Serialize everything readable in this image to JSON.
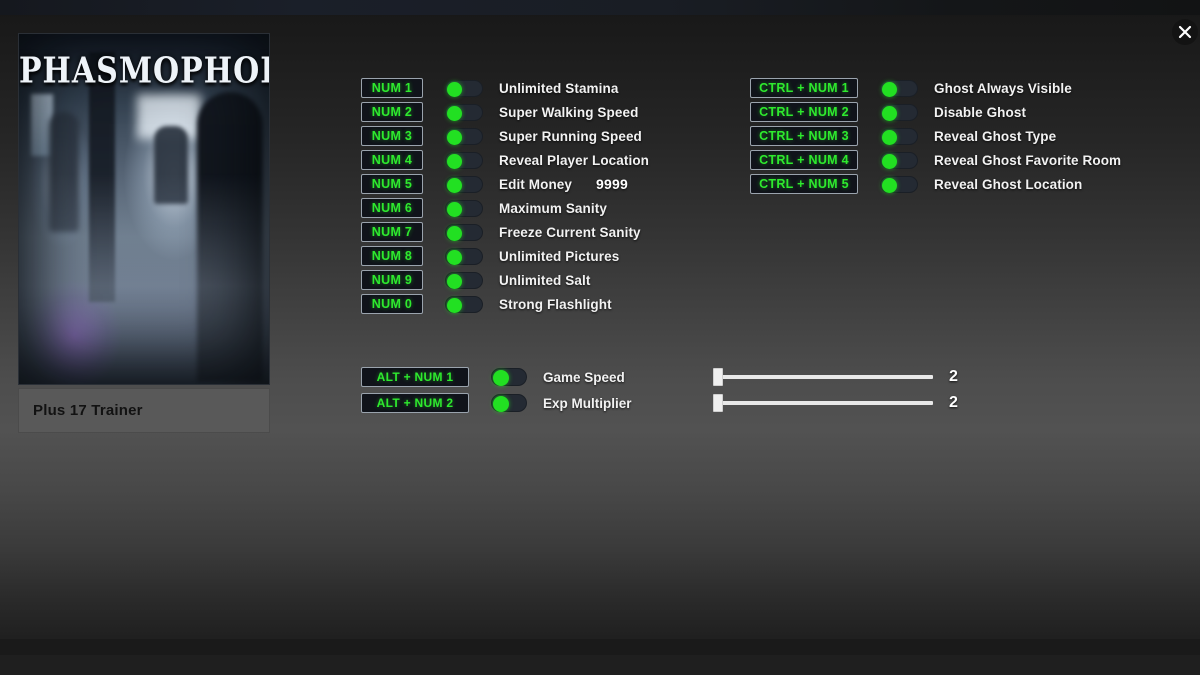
{
  "window": {
    "close_label": "✕"
  },
  "game": {
    "title": "PHASMOPHOBIA",
    "trainer_label": "Plus 17 Trainer",
    "cover_alt": "phasmophobia-cover-art"
  },
  "columns": {
    "left": [
      {
        "hotkey": "NUM 1",
        "label": "Unlimited Stamina",
        "enabled": true
      },
      {
        "hotkey": "NUM 2",
        "label": "Super Walking Speed",
        "enabled": true
      },
      {
        "hotkey": "NUM 3",
        "label": "Super Running Speed",
        "enabled": true
      },
      {
        "hotkey": "NUM 4",
        "label": "Reveal Player Location",
        "enabled": true
      },
      {
        "hotkey": "NUM 5",
        "label": "Edit Money",
        "value": "9999",
        "enabled": true
      },
      {
        "hotkey": "NUM 6",
        "label": "Maximum Sanity",
        "enabled": true
      },
      {
        "hotkey": "NUM 7",
        "label": "Freeze Current Sanity",
        "enabled": true
      },
      {
        "hotkey": "NUM 8",
        "label": "Unlimited Pictures",
        "enabled": true
      },
      {
        "hotkey": "NUM 9",
        "label": "Unlimited Salt",
        "enabled": true
      },
      {
        "hotkey": "NUM 0",
        "label": "Strong Flashlight",
        "enabled": true
      }
    ],
    "right": [
      {
        "hotkey": "CTRL + NUM 1",
        "label": "Ghost Always Visible",
        "enabled": true
      },
      {
        "hotkey": "CTRL + NUM 2",
        "label": "Disable Ghost",
        "enabled": true
      },
      {
        "hotkey": "CTRL + NUM 3",
        "label": "Reveal Ghost Type",
        "enabled": true
      },
      {
        "hotkey": "CTRL + NUM 4",
        "label": "Reveal Ghost Favorite Room",
        "enabled": true
      },
      {
        "hotkey": "CTRL + NUM 5",
        "label": "Reveal Ghost Location",
        "enabled": true
      }
    ],
    "sliders": [
      {
        "hotkey": "ALT + NUM 1",
        "label": "Game Speed",
        "value": "2",
        "percent": 0,
        "enabled": true
      },
      {
        "hotkey": "ALT + NUM 2",
        "label": "Exp Multiplier",
        "value": "2",
        "percent": 0,
        "enabled": true
      }
    ]
  },
  "colors": {
    "hotkey_text": "#2eea2e",
    "toggle_on": "#22e022",
    "label_text": "#f2f2f2",
    "panel_bg": "#595959"
  }
}
